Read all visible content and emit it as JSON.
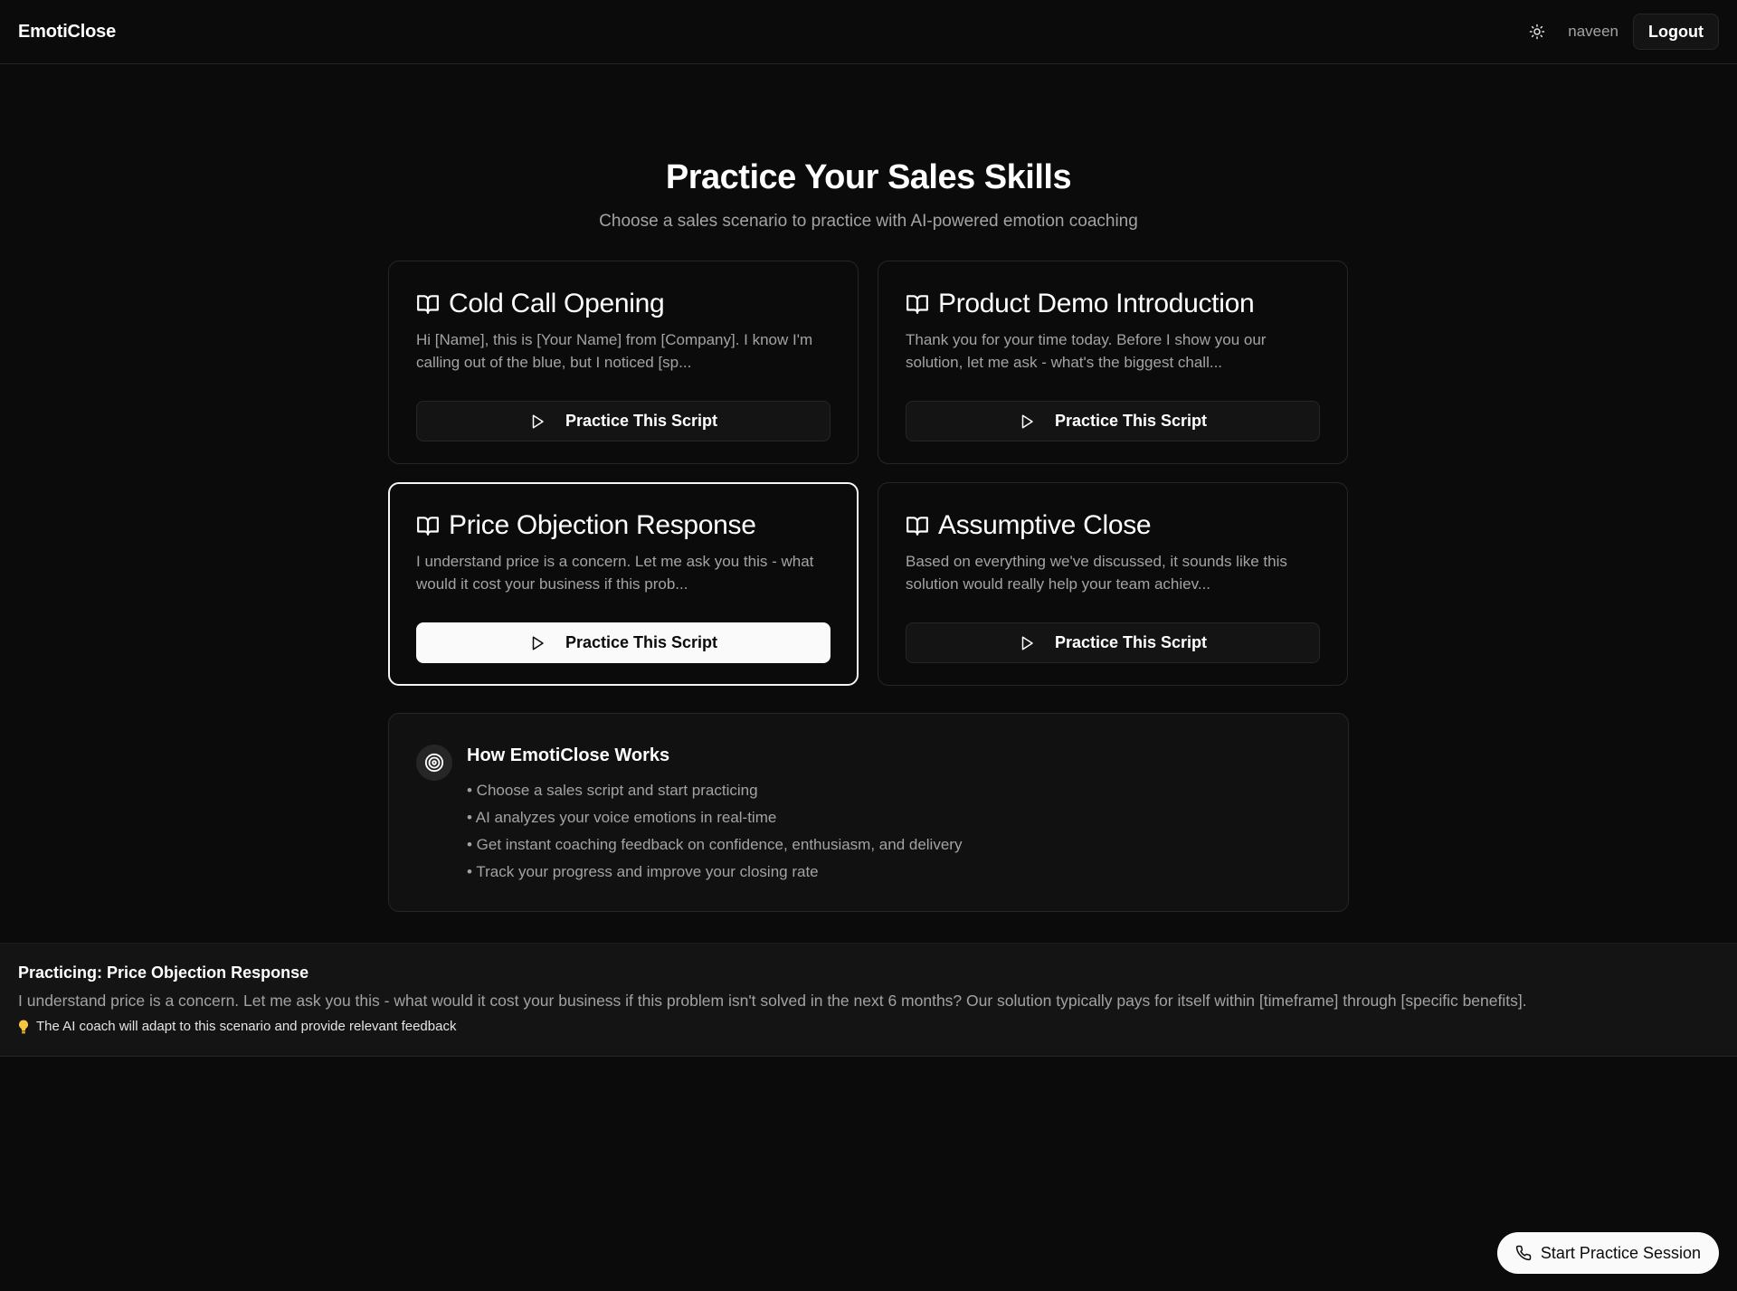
{
  "header": {
    "brand": "EmotiClose",
    "username": "naveen",
    "logout_label": "Logout"
  },
  "hero": {
    "title": "Practice Your Sales Skills",
    "subtitle": "Choose a sales scenario to practice with AI-powered emotion coaching"
  },
  "scripts": [
    {
      "title": "Cold Call Opening",
      "preview": "Hi [Name], this is [Your Name] from [Company]. I know I'm calling out of the blue, but I noticed [sp...",
      "button_label": "Practice This Script",
      "selected": false
    },
    {
      "title": "Product Demo Introduction",
      "preview": "Thank you for your time today. Before I show you our solution, let me ask - what's the biggest chall...",
      "button_label": "Practice This Script",
      "selected": false
    },
    {
      "title": "Price Objection Response",
      "preview": "I understand price is a concern. Let me ask you this - what would it cost your business if this prob...",
      "button_label": "Practice This Script",
      "selected": true
    },
    {
      "title": "Assumptive Close",
      "preview": "Based on everything we've discussed, it sounds like this solution would really help your team achiev...",
      "button_label": "Practice This Script",
      "selected": false
    }
  ],
  "how_it_works": {
    "title": "How EmotiClose Works",
    "items": [
      "• Choose a sales script and start practicing",
      "• AI analyzes your voice emotions in real-time",
      "• Get instant coaching feedback on confidence, enthusiasm, and delivery",
      "• Track your progress and improve your closing rate"
    ]
  },
  "practicing": {
    "title": "Practicing: Price Objection Response",
    "text": "I understand price is a concern. Let me ask you this - what would it cost your business if this problem isn't solved in the next 6 months? Our solution typically pays for itself within [timeframe] through [specific benefits].",
    "tip": "The AI coach will adapt to this scenario and provide relevant feedback"
  },
  "start_session_label": "Start Practice Session",
  "colors": {
    "background": "#0b0b0b",
    "panel": "#141414",
    "border": "#262626",
    "text_muted": "#a3a3a3",
    "selected_border": "#f5f5f5"
  },
  "icons": {
    "theme": "sun-icon",
    "card": "book-open-icon",
    "button": "play-icon",
    "how": "target-icon",
    "tip": "lightbulb-icon",
    "start": "phone-icon"
  }
}
